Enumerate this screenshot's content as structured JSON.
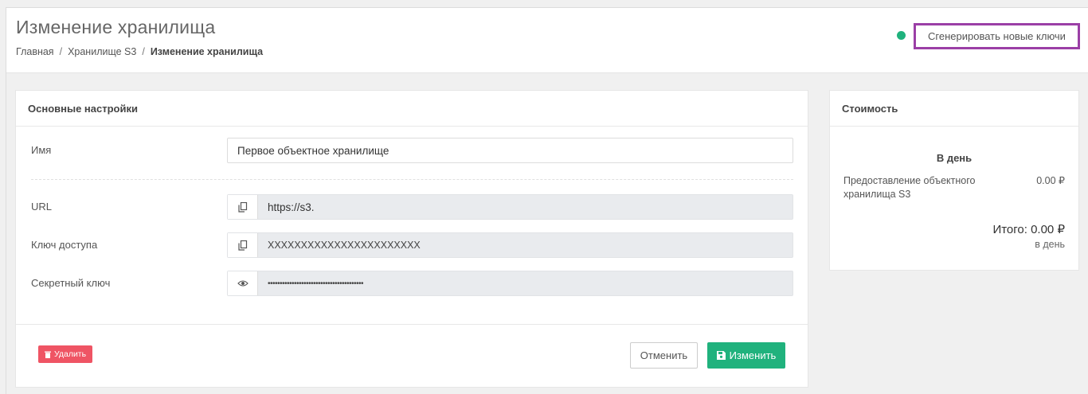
{
  "header": {
    "title": "Изменение хранилища",
    "breadcrumb": {
      "home": "Главная",
      "parent": "Хранилище S3",
      "current": "Изменение хранилища",
      "separator": "/"
    },
    "generate_keys_label": "Сгенерировать новые ключи",
    "status_color": "#20b27d"
  },
  "settings": {
    "title": "Основные настройки",
    "name": {
      "label": "Имя",
      "value": "Первое объектное хранилище"
    },
    "url": {
      "label": "URL",
      "value": "https://s3.",
      "icon": "copy-icon"
    },
    "access_key": {
      "label": "Ключ доступа",
      "value": "XXXXXXXXXXXXXXXXXXXXXXX",
      "icon": "copy-icon"
    },
    "secret_key": {
      "label": "Секретный ключ",
      "value": "••••••••••••••••••••••••••••••••••••••••",
      "icon": "eye-icon"
    }
  },
  "actions": {
    "delete_label": "Удалить",
    "cancel_label": "Отменить",
    "save_label": "Изменить",
    "delete_color": "#ef5464",
    "save_color": "#20b27d"
  },
  "cost": {
    "title": "Стоимость",
    "period": "В день",
    "item_label": "Предоставление объектного хранилища S3",
    "item_value": "0.00 ₽",
    "total": "Итого: 0.00 ₽",
    "per": "в день"
  }
}
